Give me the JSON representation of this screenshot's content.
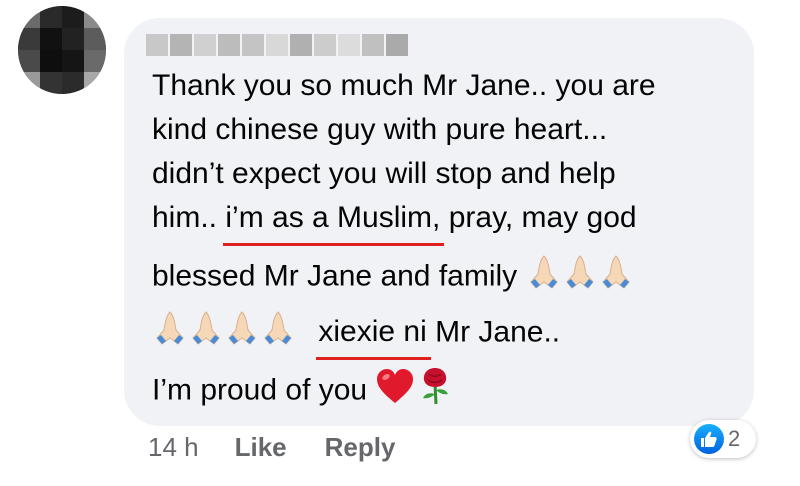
{
  "comment": {
    "lines": [
      "Thank you so much Mr Jane.. you are",
      "kind chinese guy with pure heart...",
      "didn’t expect you will stop and help",
      "him..",
      "i’m as a Muslim,",
      "pray, may god",
      "blessed Mr Jane and family",
      "xiexie ni",
      "Mr Jane..",
      "I’m proud of you"
    ]
  },
  "icons": {
    "prayer": "folded-hands-icon",
    "heart": "red-heart-icon",
    "rose": "rose-icon",
    "like": "thumbs-up-icon"
  },
  "footer": {
    "time": "14 h",
    "like_label": "Like",
    "reply_label": "Reply"
  },
  "reactions": {
    "count": "2"
  },
  "colors": {
    "bubble": "#f0f2f5",
    "underline": "#e02020",
    "like_blue": "#1877f2",
    "secondary_text": "#65676b"
  }
}
